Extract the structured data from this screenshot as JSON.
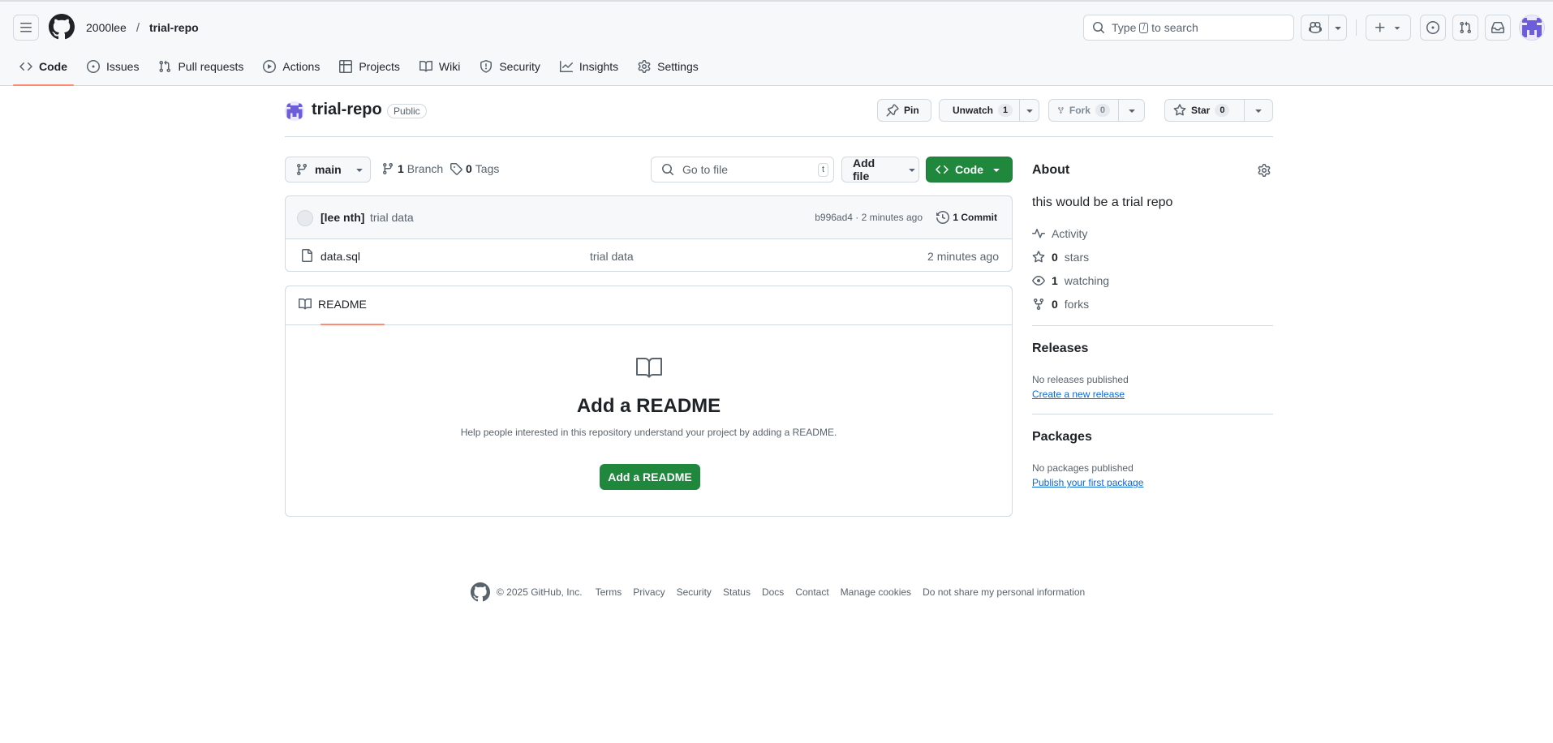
{
  "header": {
    "owner": "2000lee",
    "separator": "/",
    "repo": "trial-repo",
    "search": {
      "prefix": "Type",
      "key": "/",
      "suffix": "to search"
    }
  },
  "nav": {
    "tabs": [
      {
        "label": "Code",
        "icon": "code-icon",
        "selected": true
      },
      {
        "label": "Issues",
        "icon": "issue-opened-icon"
      },
      {
        "label": "Pull requests",
        "icon": "git-pull-request-icon"
      },
      {
        "label": "Actions",
        "icon": "play-icon"
      },
      {
        "label": "Projects",
        "icon": "table-icon"
      },
      {
        "label": "Wiki",
        "icon": "book-icon"
      },
      {
        "label": "Security",
        "icon": "shield-icon"
      },
      {
        "label": "Insights",
        "icon": "graph-icon"
      },
      {
        "label": "Settings",
        "icon": "gear-icon"
      }
    ]
  },
  "repo": {
    "name": "trial-repo",
    "visibility": "Public",
    "pin_label": "Pin",
    "unwatch_label": "Unwatch",
    "watch_count": "1",
    "fork_label": "Fork",
    "fork_count": "0",
    "star_label": "Star",
    "star_count": "0"
  },
  "filenav": {
    "branch": "main",
    "branches_count": "1",
    "branches_label": "Branch",
    "tags_count": "0",
    "tags_label": "Tags",
    "goto_placeholder": "Go to file",
    "goto_key": "t",
    "add_file_label": "Add file",
    "code_label": "Code"
  },
  "commit": {
    "author": "[lee nth]",
    "message": "trial data",
    "meta": "b996ad4 · 2 minutes ago",
    "count_label": "1 Commit"
  },
  "files": [
    {
      "name": "data.sql",
      "commit": "trial data",
      "time": "2 minutes ago"
    }
  ],
  "readme": {
    "tab_label": "README",
    "title": "Add a README",
    "description": "Help people interested in this repository understand your project by adding a README.",
    "button_label": "Add a README"
  },
  "about": {
    "title": "About",
    "description": "this would be a trial repo",
    "activity": "Activity",
    "stars_count": "0",
    "stars_label": "stars",
    "watching_count": "1",
    "watching_label": "watching",
    "forks_count": "0",
    "forks_label": "forks"
  },
  "releases": {
    "title": "Releases",
    "empty": "No releases published",
    "link": "Create a new release"
  },
  "packages": {
    "title": "Packages",
    "empty": "No packages published",
    "link": "Publish your first package"
  },
  "footer": {
    "copyright": "© 2025 GitHub, Inc.",
    "links": [
      "Terms",
      "Privacy",
      "Security",
      "Status",
      "Docs",
      "Contact",
      "Manage cookies",
      "Do not share my personal information"
    ]
  },
  "colors": {
    "accent_underline": "#fd8c73",
    "primary_green": "#1f883d",
    "link_blue": "#0969da",
    "muted": "#59636e",
    "border": "#d1d9e0"
  }
}
